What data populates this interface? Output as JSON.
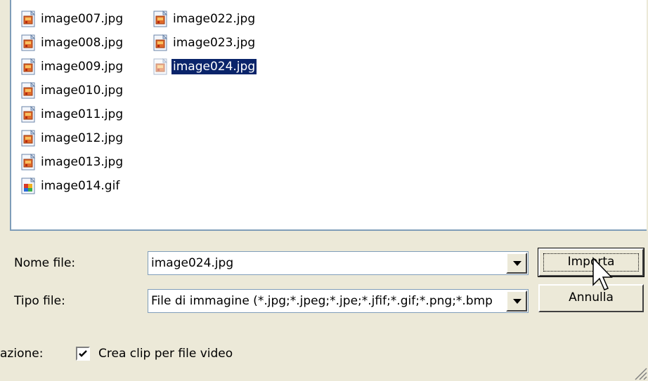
{
  "files": {
    "column1": [
      {
        "name": "image007.jpg",
        "icon": "jpg-file-icon"
      },
      {
        "name": "image008.jpg",
        "icon": "jpg-file-icon"
      },
      {
        "name": "image009.jpg",
        "icon": "jpg-file-icon"
      },
      {
        "name": "image010.jpg",
        "icon": "jpg-file-icon"
      },
      {
        "name": "image011.jpg",
        "icon": "jpg-file-icon"
      },
      {
        "name": "image012.jpg",
        "icon": "jpg-file-icon"
      },
      {
        "name": "image013.jpg",
        "icon": "jpg-file-icon"
      },
      {
        "name": "image014.gif",
        "icon": "gif-file-icon"
      }
    ],
    "column2": [
      {
        "name": "image022.jpg",
        "icon": "jpg-file-icon"
      },
      {
        "name": "image023.jpg",
        "icon": "jpg-file-icon"
      },
      {
        "name": "image024.jpg",
        "icon": "jpg-file-icon",
        "selected": true
      }
    ]
  },
  "filename": {
    "label": "Nome file:",
    "value": "image024.jpg"
  },
  "filetype": {
    "label": "Tipo file:",
    "value": "File di immagine (*.jpg;*.jpeg;*.jpe;*.jfif;*.gif;*.png;*.bmp"
  },
  "buttons": {
    "import_label": "Importa",
    "cancel_label": "Annulla"
  },
  "options": {
    "label": "azione:",
    "checkbox_label": "Crea clip per file video",
    "checkbox_checked": true
  },
  "colors": {
    "dialog_bg": "#ece9d8",
    "selection_bg": "#0a246a",
    "border": "#7f9db9"
  },
  "icons": {
    "combo_dropdown": "chevron-down-icon",
    "cursor": "mouse-pointer-icon",
    "resize": "resize-grip-icon"
  }
}
